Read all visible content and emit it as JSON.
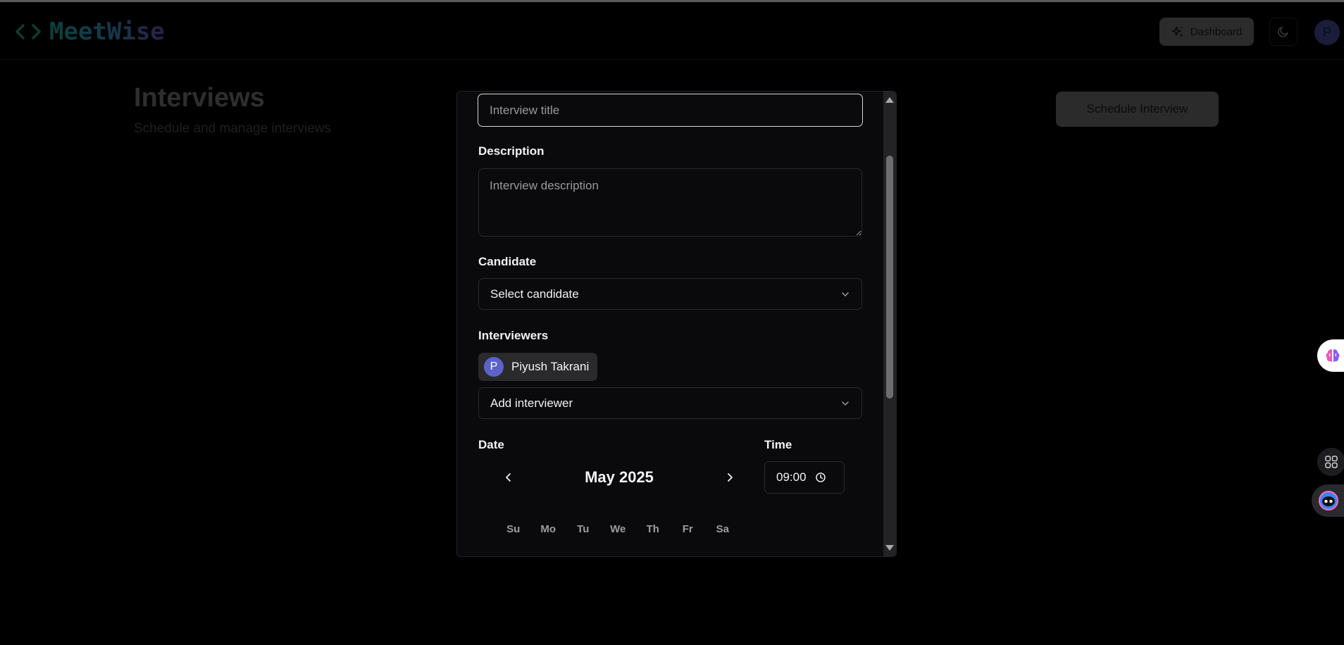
{
  "app": {
    "logo_text": "MeetWise",
    "logo_icon": "code-brackets-icon"
  },
  "header": {
    "dashboard_label": "Dashboard",
    "theme_icon": "moon-icon",
    "avatar_initial": "P"
  },
  "page": {
    "title": "Interviews",
    "subtitle": "Schedule and manage interviews",
    "schedule_label": "Schedule Interview"
  },
  "form": {
    "title_placeholder": "Interview title",
    "title_value": "",
    "description_label": "Description",
    "description_placeholder": "Interview description",
    "candidate_label": "Candidate",
    "candidate_select": "Select candidate",
    "interviewers_label": "Interviewers",
    "interviewers": [
      {
        "initial": "P",
        "name": "Piyush Takrani"
      }
    ],
    "add_interviewer": "Add interviewer",
    "date_label": "Date",
    "time_label": "Time",
    "time_value": "09:00"
  },
  "calendar": {
    "month": "May 2025",
    "weekdays": [
      "Su",
      "Mo",
      "Tu",
      "We",
      "Th",
      "Fr",
      "Sa"
    ]
  },
  "colors": {
    "background": "#000000",
    "modal": "#0a0a0c",
    "chip_avatar": "#5b63c9",
    "accent_border": "#d9d9d9"
  }
}
